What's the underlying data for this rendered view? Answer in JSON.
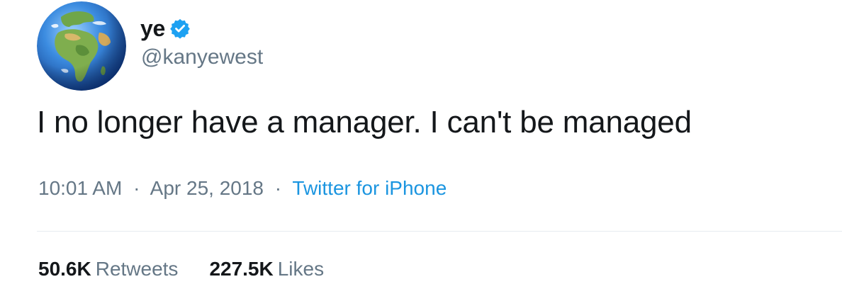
{
  "user": {
    "display_name": "ye",
    "handle": "@kanyewest",
    "verified": true,
    "avatar_icon": "globe-africa-europe-icon"
  },
  "tweet": {
    "text": "I no longer have a manager. I can't be managed"
  },
  "meta": {
    "time": "10:01 AM",
    "separator": "·",
    "date": "Apr 25, 2018",
    "source": "Twitter for iPhone"
  },
  "stats": {
    "retweets_count": "50.6K",
    "retweets_label": "Retweets",
    "likes_count": "227.5K",
    "likes_label": "Likes"
  },
  "colors": {
    "text": "#14171a",
    "secondary": "#657786",
    "link": "#1b95e0",
    "verified": "#1da1f2",
    "divider": "#e6ecf0"
  }
}
